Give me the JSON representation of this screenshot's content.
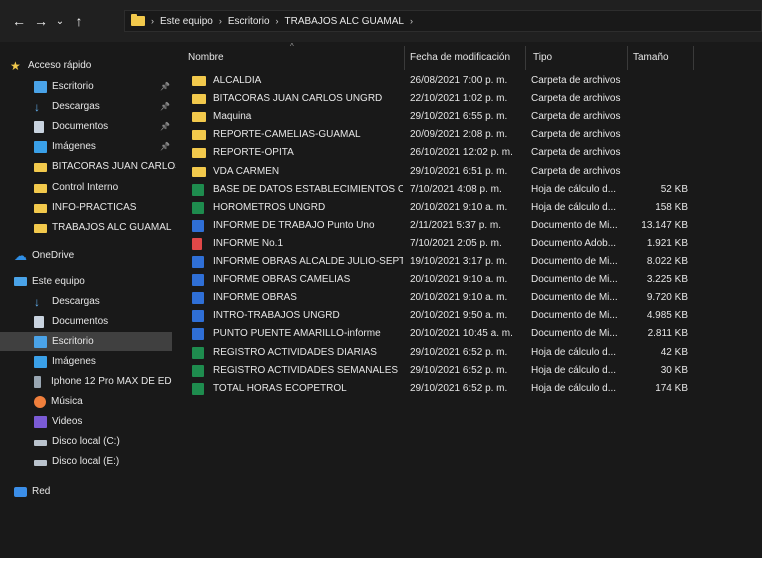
{
  "breadcrumb": [
    "Este equipo",
    "Escritorio",
    "TRABAJOS ALC GUAMAL"
  ],
  "columns": {
    "name": "Nombre",
    "date": "Fecha de modificación",
    "type": "Tipo",
    "size": "Tamaño"
  },
  "sidebar": [
    {
      "label": "Acceso rápido",
      "icon": "star-icon",
      "pinned": false
    },
    {
      "label": "Escritorio",
      "icon": "desktop-icon",
      "pinned": true
    },
    {
      "label": "Descargas",
      "icon": "download-icon",
      "pinned": true
    },
    {
      "label": "Documentos",
      "icon": "documents-icon",
      "pinned": true
    },
    {
      "label": "Imágenes",
      "icon": "pictures-icon",
      "pinned": true
    },
    {
      "label": "BITACORAS JUAN CARLOS",
      "icon": "folder-icon",
      "pinned": false
    },
    {
      "label": "Control Interno",
      "icon": "folder-icon",
      "pinned": false
    },
    {
      "label": "INFO-PRACTICAS",
      "icon": "folder-icon",
      "pinned": false
    },
    {
      "label": "TRABAJOS ALC GUAMAL",
      "icon": "folder-icon",
      "pinned": false
    },
    {
      "label": "OneDrive",
      "icon": "onedrive-icon",
      "pinned": false
    },
    {
      "label": "Este equipo",
      "icon": "pc-icon",
      "pinned": false
    },
    {
      "label": "Descargas",
      "icon": "download-icon",
      "pinned": false
    },
    {
      "label": "Documentos",
      "icon": "documents-icon",
      "pinned": false
    },
    {
      "label": "Escritorio",
      "icon": "desktop-icon",
      "pinned": false,
      "selected": true
    },
    {
      "label": "Imágenes",
      "icon": "pictures-icon",
      "pinned": false
    },
    {
      "label": "Iphone 12 Pro MAX DE ED",
      "icon": "phone-icon",
      "pinned": false
    },
    {
      "label": "Música",
      "icon": "music-icon",
      "pinned": false
    },
    {
      "label": "Videos",
      "icon": "videos-icon",
      "pinned": false
    },
    {
      "label": "Disco local (C:)",
      "icon": "drive-icon",
      "pinned": false
    },
    {
      "label": "Disco local (E:)",
      "icon": "drive-icon",
      "pinned": false
    },
    {
      "label": "Red",
      "icon": "network-icon",
      "pinned": false
    }
  ],
  "files": [
    {
      "name": "ALCALDIA",
      "date": "26/08/2021 7:00 p. m.",
      "type": "Carpeta de archivos",
      "size": "",
      "icon": "folder"
    },
    {
      "name": "BITACORAS JUAN CARLOS UNGRD",
      "date": "22/10/2021 1:02 p. m.",
      "type": "Carpeta de archivos",
      "size": "",
      "icon": "folder"
    },
    {
      "name": "Maquina",
      "date": "29/10/2021 6:55 p. m.",
      "type": "Carpeta de archivos",
      "size": "",
      "icon": "folder"
    },
    {
      "name": "REPORTE-CAMELIAS-GUAMAL",
      "date": "20/09/2021 2:08 p. m.",
      "type": "Carpeta de archivos",
      "size": "",
      "icon": "folder"
    },
    {
      "name": "REPORTE-OPITA",
      "date": "26/10/2021 12:02 p. m.",
      "type": "Carpeta de archivos",
      "size": "",
      "icon": "folder"
    },
    {
      "name": "VDA CARMEN",
      "date": "29/10/2021 6:51 p. m.",
      "type": "Carpeta de archivos",
      "size": "",
      "icon": "folder"
    },
    {
      "name": "BASE DE DATOS ESTABLECIMIENTOS CO...",
      "date": "7/10/2021 4:08 p. m.",
      "type": "Hoja de cálculo d...",
      "size": "52 KB",
      "icon": "excel"
    },
    {
      "name": "HOROMETROS UNGRD",
      "date": "20/10/2021 9:10 a. m.",
      "type": "Hoja de cálculo d...",
      "size": "158 KB",
      "icon": "excel"
    },
    {
      "name": "INFORME DE TRABAJO Punto Uno",
      "date": "2/11/2021 5:37 p. m.",
      "type": "Documento de Mi...",
      "size": "13.147 KB",
      "icon": "word"
    },
    {
      "name": "INFORME No.1",
      "date": "7/10/2021 2:05 p. m.",
      "type": "Documento Adob...",
      "size": "1.921 KB",
      "icon": "pdf"
    },
    {
      "name": "INFORME OBRAS ALCALDE JULIO-SEPTIE...",
      "date": "19/10/2021 3:17 p. m.",
      "type": "Documento de Mi...",
      "size": "8.022 KB",
      "icon": "word"
    },
    {
      "name": "INFORME OBRAS CAMELIAS",
      "date": "20/10/2021 9:10 a. m.",
      "type": "Documento de Mi...",
      "size": "3.225 KB",
      "icon": "word"
    },
    {
      "name": "INFORME OBRAS",
      "date": "20/10/2021 9:10 a. m.",
      "type": "Documento de Mi...",
      "size": "9.720 KB",
      "icon": "word"
    },
    {
      "name": "INTRO-TRABAJOS UNGRD",
      "date": "20/10/2021 9:50 a. m.",
      "type": "Documento de Mi...",
      "size": "4.985 KB",
      "icon": "word"
    },
    {
      "name": "PUNTO PUENTE AMARILLO-informe",
      "date": "20/10/2021 10:45 a. m.",
      "type": "Documento de Mi...",
      "size": "2.811 KB",
      "icon": "word"
    },
    {
      "name": "REGISTRO ACTIVIDADES DIARIAS",
      "date": "29/10/2021 6:52 p. m.",
      "type": "Hoja de cálculo d...",
      "size": "42 KB",
      "icon": "excel"
    },
    {
      "name": "REGISTRO ACTIVIDADES SEMANALES",
      "date": "29/10/2021 6:52 p. m.",
      "type": "Hoja de cálculo d...",
      "size": "30 KB",
      "icon": "excel"
    },
    {
      "name": "TOTAL HORAS ECOPETROL",
      "date": "29/10/2021 6:52 p. m.",
      "type": "Hoja de cálculo d...",
      "size": "174 KB",
      "icon": "excel"
    }
  ]
}
